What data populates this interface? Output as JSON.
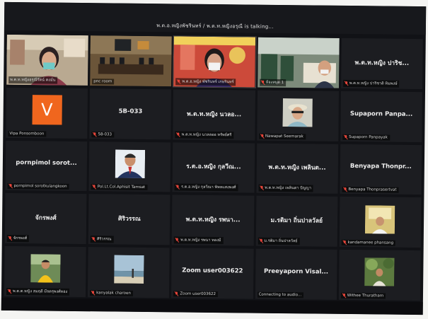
{
  "meeting": {
    "talking_text": "พ.ต.อ.หญิงพัชรินทร์ / พ.ต.ท.หญิงอรุณี is talking..."
  },
  "tiles": [
    {
      "id": 0,
      "kind": "video",
      "scene": "woman-mask-office",
      "label": "พ.ต.ท.หญิงอรุณีรัตน์ คงมั่น",
      "muted": false,
      "name": ""
    },
    {
      "id": 1,
      "kind": "video",
      "scene": "conference-room",
      "label": "pnc room",
      "muted": false,
      "name": ""
    },
    {
      "id": 2,
      "kind": "video",
      "scene": "woman-mask-poster",
      "label": "พ.ต.อ.หญิง พัชรินทร์ เกษรินทร์",
      "muted": true,
      "name": ""
    },
    {
      "id": 3,
      "kind": "video",
      "scene": "library-man",
      "label": "ห้องสมุด 1",
      "muted": true,
      "name": ""
    },
    {
      "id": 4,
      "kind": "name",
      "scene": "",
      "label": "พ.ต.ท.หญิง ปาริชาติ ทิมพงษ์",
      "muted": true,
      "name": "พ.ต.ท.หญิง ปาริช..."
    },
    {
      "id": 5,
      "kind": "avatar",
      "scene": "",
      "label": "Vipa Ponsomboon",
      "muted": false,
      "name": "",
      "avatar_letter": "V"
    },
    {
      "id": 6,
      "kind": "name",
      "scene": "",
      "label": "58-033",
      "muted": true,
      "name": "5B-033"
    },
    {
      "id": 7,
      "kind": "name",
      "scene": "",
      "label": "พ.ต.ท.หญิง นวลลออ ทรัพย์ศรี",
      "muted": true,
      "name": "พ.ต.ท.หญิง นวลอ..."
    },
    {
      "id": 8,
      "kind": "photo",
      "scene": "woman-hat",
      "label": "Nawapat Seemarak",
      "muted": true,
      "name": ""
    },
    {
      "id": 9,
      "kind": "name",
      "scene": "",
      "label": "Supaporn Panpayak",
      "muted": true,
      "name": "Supaporn Panpa..."
    },
    {
      "id": 10,
      "kind": "name",
      "scene": "",
      "label": "pornpimol sorotkulangkoon",
      "muted": true,
      "name": "pornpimol sorot..."
    },
    {
      "id": 11,
      "kind": "photo",
      "scene": "man-suit",
      "label": "Pol.Lt.Col.Aphisit Tamsat",
      "muted": true,
      "name": ""
    },
    {
      "id": 12,
      "kind": "name",
      "scene": "",
      "label": "ร.ต.อ.หญิง กุลวีณา พิพลแสงพงศ์",
      "muted": true,
      "name": "ร.ต.อ.หญิง กุลวีณ..."
    },
    {
      "id": 13,
      "kind": "name",
      "scene": "",
      "label": "พ.ต.ท.หญิง เพลินตา ปัญญา",
      "muted": true,
      "name": "พ.ต.ท.หญิง เพลินต..."
    },
    {
      "id": 14,
      "kind": "name",
      "scene": "",
      "label": "Benyapa Thonprasertvat",
      "muted": true,
      "name": "Benyapa Thonpr..."
    },
    {
      "id": 15,
      "kind": "name",
      "scene": "",
      "label": "จักรพงศ์",
      "muted": true,
      "name": "จักรพงศ์"
    },
    {
      "id": 16,
      "kind": "name",
      "scene": "",
      "label": "ศิริวรรณ",
      "muted": true,
      "name": "ศิริวรรณ"
    },
    {
      "id": 17,
      "kind": "name",
      "scene": "",
      "label": "พ.ต.ท.หญิง รพนา ทองมี",
      "muted": true,
      "name": "พ.ต.ท.หญิง รพนา..."
    },
    {
      "id": 18,
      "kind": "name",
      "scene": "",
      "label": "ม.รติมา ถิ่นปาลวัลย์",
      "muted": true,
      "name": "ม.รติมา ถิ่นปาลวัลย์"
    },
    {
      "id": 19,
      "kind": "photo",
      "scene": "person-sign",
      "label": "kandamanee phansang",
      "muted": true,
      "name": ""
    },
    {
      "id": 20,
      "kind": "photo",
      "scene": "woman-yellow",
      "label": "พ.ต.ต.หญิง สมฤดี มีจตรุพงศ์ทอง",
      "muted": true,
      "name": ""
    },
    {
      "id": 21,
      "kind": "photo",
      "scene": "beach",
      "label": "kanyalak charoen",
      "muted": true,
      "name": ""
    },
    {
      "id": 22,
      "kind": "name",
      "scene": "",
      "label": "Zoom user003622",
      "muted": true,
      "name": "Zoom user003622"
    },
    {
      "id": 23,
      "kind": "name",
      "scene": "",
      "label": "Connecting to audio...",
      "muted": false,
      "name": "Preeyaporn Visal..."
    },
    {
      "id": 24,
      "kind": "photo",
      "scene": "garden-person",
      "label": "Withee Thuratham",
      "muted": true,
      "name": ""
    }
  ]
}
